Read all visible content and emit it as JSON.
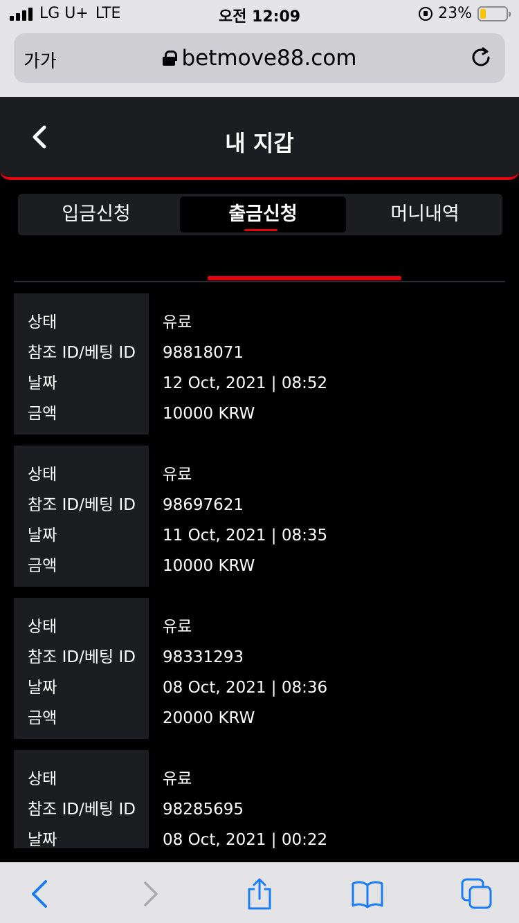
{
  "status_bar": {
    "carrier": "LG U+",
    "network": "LTE",
    "time": "오전 12:09",
    "battery": "23%",
    "battery_level": 0.23,
    "battery_color": "#f7c600"
  },
  "browser": {
    "text_size_label": "가가",
    "url": "betmove88.com",
    "icons": [
      "lock-icon",
      "reload-icon",
      "back-icon",
      "forward-icon",
      "share-icon",
      "bookmarks-icon",
      "tabs-icon"
    ]
  },
  "header": {
    "title": "내 지갑"
  },
  "tabs": [
    {
      "label": "입금신청",
      "active": false
    },
    {
      "label": "출금신청",
      "active": true
    },
    {
      "label": "머니내역",
      "active": false
    }
  ],
  "colors": {
    "accent": "#e8000d",
    "panel": "#1c1d21",
    "link_blue": "#1a7cf5"
  },
  "record_labels": {
    "status": "상태",
    "ref_id": "참조 ID/베팅 ID",
    "date": "날짜",
    "amount": "금액"
  },
  "records": [
    {
      "status": "유료",
      "ref_id": "98818071",
      "date": "12 Oct, 2021 | 08:52",
      "amount": "10000 KRW"
    },
    {
      "status": "유료",
      "ref_id": "98697621",
      "date": "11 Oct, 2021 | 08:35",
      "amount": "10000 KRW"
    },
    {
      "status": "유료",
      "ref_id": "98331293",
      "date": "08 Oct, 2021 | 08:36",
      "amount": "20000 KRW"
    },
    {
      "status": "유료",
      "ref_id": "98285695",
      "date": "08 Oct, 2021 | 00:22",
      "amount": ""
    }
  ]
}
